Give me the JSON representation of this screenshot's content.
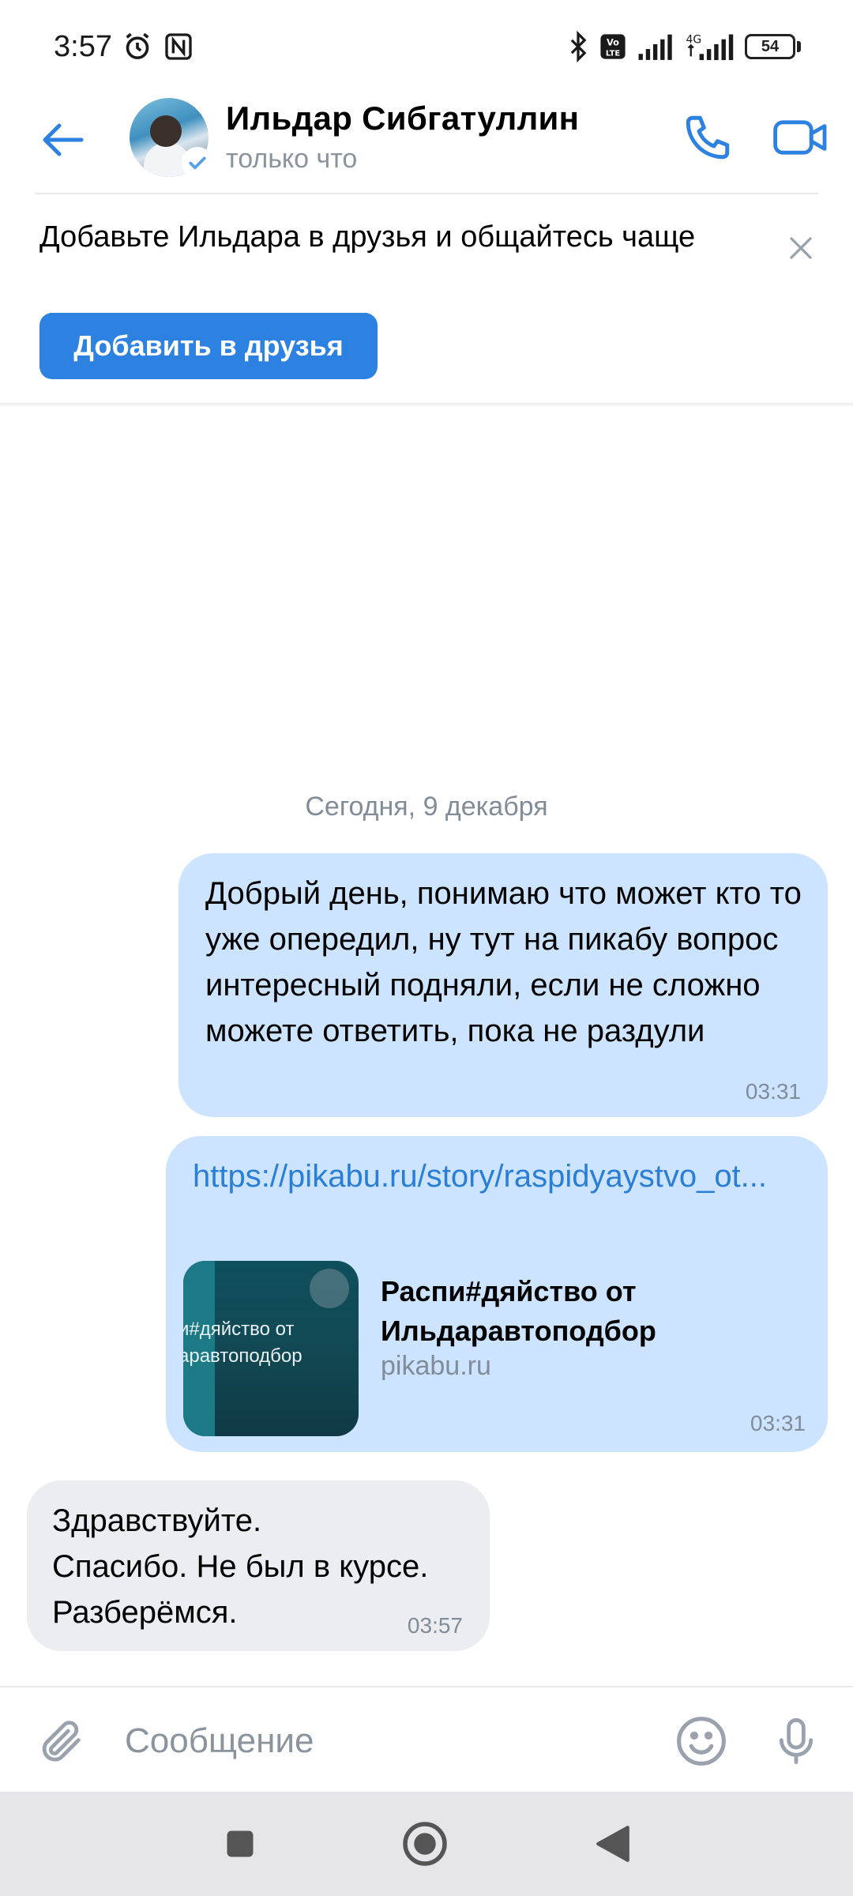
{
  "status_bar": {
    "time": "3:57",
    "icons": [
      "alarm-icon",
      "nfc-icon",
      "bluetooth-icon",
      "volte-icon",
      "signal-icon",
      "signal-4g-icon"
    ],
    "network_label": "4G",
    "battery": "54"
  },
  "header": {
    "contact_name": "Ильдар Сибгатуллин",
    "contact_status": "только что",
    "accent": "#2d81e0"
  },
  "banner": {
    "text": "Добавьте Ильдара в друзья и общайтесь чаще",
    "button_label": "Добавить в друзья"
  },
  "chat": {
    "date_separator": "Сегодня, 9 декабря",
    "messages": [
      {
        "direction": "out",
        "text": "Добрый день, понимаю что может кто то уже опередил, ну тут на пикабу вопрос интересный подняли, если не сложно можете ответить, пока не раздули",
        "time": "03:31"
      },
      {
        "direction": "out",
        "link_url": "https://pikabu.ru/story/raspidyaystvo_ot...",
        "link_title": "Распи#дяйство от Ильдаравтоподбор",
        "link_domain": "pikabu.ru",
        "thumb_text": "и#дяйство от\nаравтоподбор",
        "time": "03:31"
      },
      {
        "direction": "in",
        "text": "Здравствуйте.\nСпасибо. Не был в курсе.\nРазберёмся.",
        "time": "03:57"
      }
    ]
  },
  "composer": {
    "placeholder": "Сообщение"
  },
  "colors": {
    "outgoing_bubble": "#cce4ff",
    "incoming_bubble": "#ebedf0",
    "link": "#2a7ed6",
    "secondary_text": "#818c99"
  }
}
